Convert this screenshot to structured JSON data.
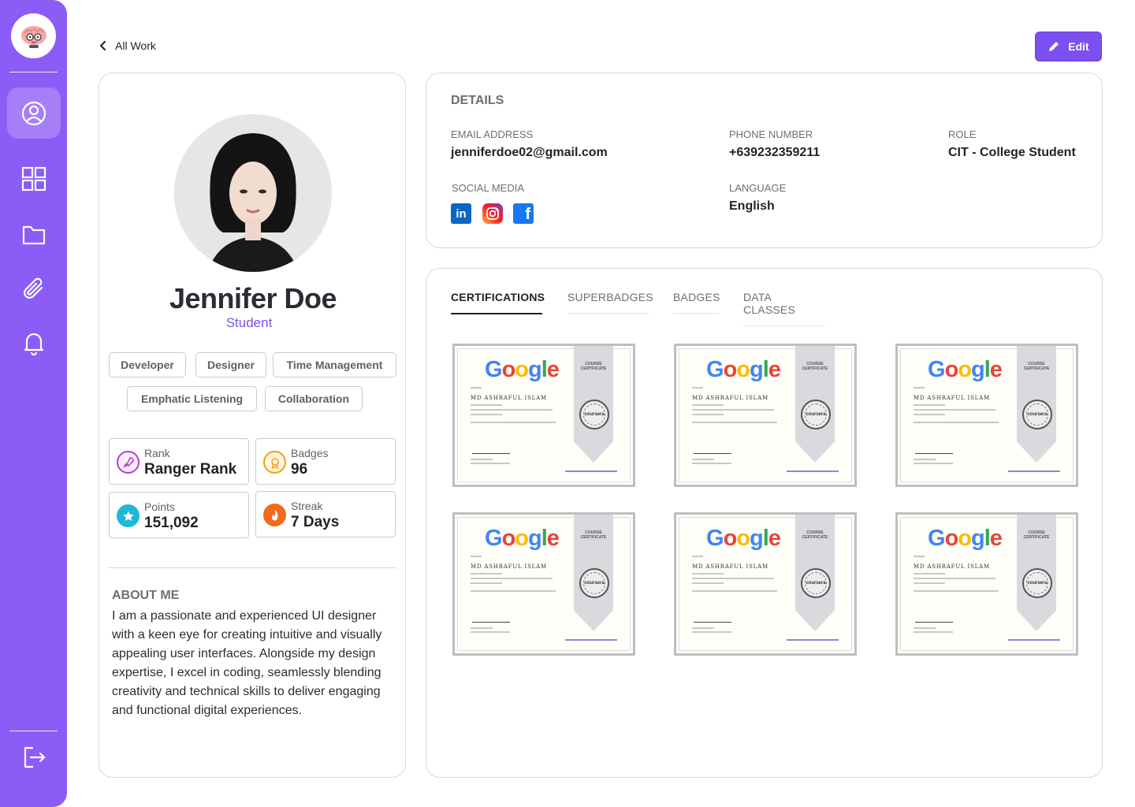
{
  "nav": {
    "items": [
      {
        "name": "profile",
        "active": true
      },
      {
        "name": "dashboard",
        "active": false
      },
      {
        "name": "folder",
        "active": false
      },
      {
        "name": "attachments",
        "active": false
      },
      {
        "name": "notifications",
        "active": false
      }
    ]
  },
  "header": {
    "back_label": "All Work",
    "edit_label": "Edit"
  },
  "profile": {
    "name": "Jennifer Doe",
    "subtitle": "Student",
    "skills": [
      "Developer",
      "Designer",
      "Time Management",
      "Emphatic Listening",
      "Collaboration"
    ],
    "stats": {
      "rank": {
        "label": "Rank",
        "value": "Ranger Rank",
        "color": "#b13fd6"
      },
      "badges": {
        "label": "Badges",
        "value": "96",
        "color": "#f0a015"
      },
      "points": {
        "label": "Points",
        "value": "151,092",
        "color": "#1fb8d8"
      },
      "streak": {
        "label": "Streak",
        "value": "7 Days",
        "color": "#f26a1b"
      }
    },
    "about_title": "ABOUT ME",
    "about_text": "I am a passionate and experienced UI designer with a keen eye for creating intuitive and visually appealing user interfaces. Alongside my design expertise, I excel in coding, seamlessly blending creativity and technical skills to deliver engaging and functional digital experiences."
  },
  "details": {
    "title": "DETAILS",
    "email_label": "EMAIL ADDRESS",
    "email": "jenniferdoe02@gmail.com",
    "phone_label": "PHONE NUMBER",
    "phone": "+639232359211",
    "role_label": "ROLE",
    "role": "CIT - College Student",
    "social_label": "SOCIAL MEDIA",
    "social": [
      "linkedin",
      "instagram",
      "facebook"
    ],
    "language_label": "LANGUAGE",
    "language": "English"
  },
  "tabs": [
    "CERTIFICATIONS",
    "SUPERBADGES",
    "BADGES",
    "DATA CLASSES"
  ],
  "active_tab": "CERTIFICATIONS",
  "certificates": {
    "logo_text": "Google",
    "ribbon_text": "COURSE CERTIFICATE",
    "recipient": "MD ASHRAFUL ISLAM",
    "seal_text": "coursera"
  },
  "colors": {
    "accent": "#8b5cf6",
    "button": "#7c4ff0"
  }
}
